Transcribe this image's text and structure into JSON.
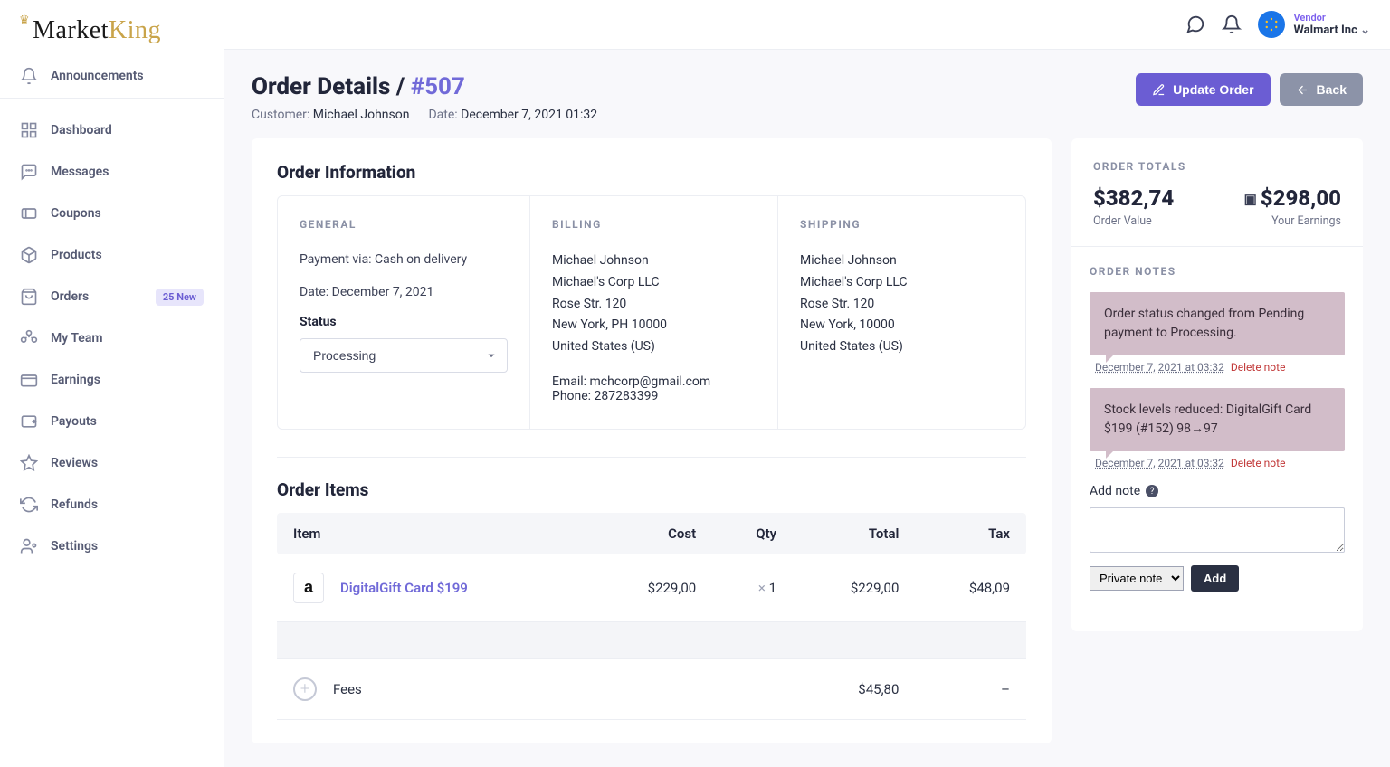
{
  "brand": {
    "left": "Market",
    "right": "King"
  },
  "announcements_label": "Announcements",
  "nav": [
    {
      "label": "Dashboard"
    },
    {
      "label": "Messages"
    },
    {
      "label": "Coupons"
    },
    {
      "label": "Products"
    },
    {
      "label": "Orders",
      "badge": "25 New"
    },
    {
      "label": "My Team"
    },
    {
      "label": "Earnings"
    },
    {
      "label": "Payouts"
    },
    {
      "label": "Reviews"
    },
    {
      "label": "Refunds"
    },
    {
      "label": "Settings"
    }
  ],
  "topbar": {
    "role": "Vendor",
    "vendor_name": "Walmart Inc"
  },
  "page": {
    "title_prefix": "Order Details / ",
    "order_no": "#507",
    "customer_label": "Customer: ",
    "customer_name": "Michael Johnson",
    "date_label": "Date: ",
    "date_value": "December 7, 2021 01:32",
    "update_btn": "Update Order",
    "back_btn": "Back"
  },
  "order_info": {
    "heading": "Order Information",
    "general": {
      "title": "GENERAL",
      "payment": "Payment via: Cash on delivery",
      "date": "Date: December 7, 2021",
      "status_label": "Status",
      "status_value": "Processing"
    },
    "billing": {
      "title": "BILLING",
      "name": "Michael Johnson",
      "company": "Michael's Corp LLC",
      "street": "Rose Str. 120",
      "city": "New York, PH 10000",
      "country": "United States (US)",
      "email_label": "Email: ",
      "email": "mchcorp@gmail.com",
      "phone_label": "Phone: ",
      "phone": "287283399"
    },
    "shipping": {
      "title": "SHIPPING",
      "name": "Michael Johnson",
      "company": "Michael's Corp LLC",
      "street": "Rose Str. 120",
      "city": "New York, 10000",
      "country": "United States (US)"
    }
  },
  "items": {
    "heading": "Order Items",
    "cols": {
      "item": "Item",
      "cost": "Cost",
      "qty": "Qty",
      "total": "Total",
      "tax": "Tax"
    },
    "rows": [
      {
        "name": "DigitalGift Card $199",
        "cost": "$229,00",
        "qty_prefix": "× ",
        "qty": "1",
        "total": "$229,00",
        "tax": "$48,09"
      }
    ],
    "fees": {
      "label": "Fees",
      "total": "$45,80",
      "tax": "–"
    }
  },
  "totals": {
    "heading": "ORDER TOTALS",
    "value_amount": "$382,74",
    "value_label": "Order Value",
    "earnings_amount": "$298,00",
    "earnings_label": "Your Earnings",
    "notes_heading": "ORDER NOTES",
    "notes": [
      {
        "text": "Order status changed from Pending payment to Processing.",
        "ts": "December 7, 2021 at 03:32",
        "del": "Delete note"
      },
      {
        "text": "Stock levels reduced: DigitalGift Card $199 (#152) 98→97",
        "ts": "December 7, 2021 at 03:32",
        "del": "Delete note"
      }
    ],
    "add_note_label": "Add note",
    "note_type": "Private note",
    "add_btn": "Add"
  }
}
